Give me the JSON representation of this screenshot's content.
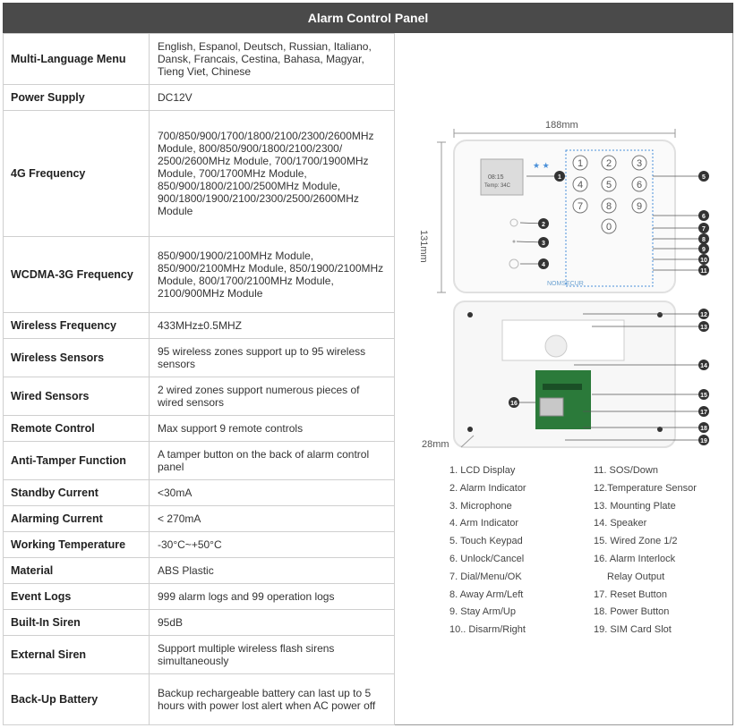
{
  "title": "Alarm Control Panel",
  "specs": [
    {
      "key": "Multi-Language Menu",
      "value": "English, Espanol, Deutsch, Russian, Italiano, Dansk, Francais, Cestina, Bahasa, Magyar, Tieng Viet, Chinese"
    },
    {
      "key": "Power Supply",
      "value": "DC12V"
    },
    {
      "key": "4G Frequency",
      "value": "700/850/900/1700/1800/2100/2300/2600MHz Module, 800/850/900/1800/2100/2300/ 2500/2600MHz Module, 700/1700/1900MHz Module, 700/1700MHz Module, 850/900/1800/2100/2500MHz Module, 900/1800/1900/2100/2300/2500/2600MHz Module"
    },
    {
      "key": "WCDMA-3G Frequency",
      "value": "850/900/1900/2100MHz Module, 850/900/2100MHz Module, 850/1900/2100MHz Module, 800/1700/2100MHz Module, 2100/900MHz Module"
    },
    {
      "key": "Wireless Frequency",
      "value": "433MHz±0.5MHZ"
    },
    {
      "key": "Wireless Sensors",
      "value": "95 wireless zones support up to 95 wireless sensors"
    },
    {
      "key": "Wired Sensors",
      "value": "2 wired zones support numerous pieces of wired sensors"
    },
    {
      "key": "Remote Control",
      "value": "Max support 9 remote controls"
    },
    {
      "key": "Anti-Tamper Function",
      "value": "A tamper button on the back of alarm control panel"
    },
    {
      "key": "Standby Current",
      "value": "<30mA"
    },
    {
      "key": "Alarming Current",
      "value": "< 270mA"
    },
    {
      "key": "Working Temperature",
      "value": "-30°C~+50°C"
    },
    {
      "key": "Material",
      "value": "ABS Plastic"
    },
    {
      "key": "Event Logs",
      "value": "999 alarm logs and 99 operation logs"
    },
    {
      "key": "Built-In Siren",
      "value": "95dB"
    },
    {
      "key": "External Siren",
      "value": "Support multiple wireless flash sirens simultaneously"
    },
    {
      "key": "Back-Up Battery",
      "value": "Backup rechargeable battery can last up to 5 hours with power lost alert when AC power off"
    }
  ],
  "diagram": {
    "width_label": "188mm",
    "height_label": "131mm",
    "depth_label": "28mm",
    "lcd_line1": "08:15",
    "lcd_line2": "Temp: 34C",
    "brand": "NOMSECUR",
    "keys": [
      "1",
      "2",
      "3",
      "4",
      "5",
      "6",
      "7",
      "8",
      "9",
      "0"
    ],
    "callouts": [
      "1",
      "2",
      "3",
      "4",
      "5",
      "6",
      "7",
      "8",
      "9",
      "10",
      "11",
      "12",
      "13",
      "14",
      "15",
      "16",
      "17",
      "18",
      "19"
    ],
    "legend_left": [
      "1. LCD Display",
      "2. Alarm Indicator",
      "3. Microphone",
      "4. Arm Indicator",
      "5. Touch Keypad",
      "6. Unlock/Cancel",
      "7. Dial/Menu/OK",
      "8. Away Arm/Left",
      "9. Stay Arm/Up",
      "10.. Disarm/Right"
    ],
    "legend_right": [
      "11. SOS/Down",
      "12.Temperature Sensor",
      "13. Mounting Plate",
      "14. Speaker",
      "15. Wired Zone 1/2",
      "16. Alarm Interlock",
      "Relay Output",
      "17. Reset Button",
      "18. Power Button",
      "19. SIM Card Slot"
    ]
  }
}
